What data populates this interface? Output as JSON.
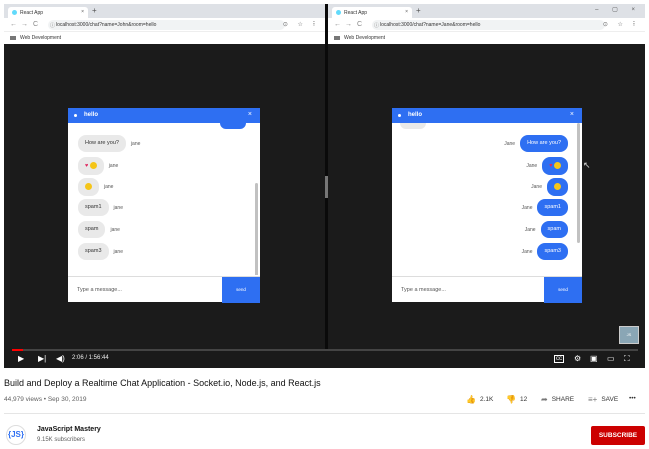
{
  "browser": {
    "tab_title": "React App",
    "tab_close": "×",
    "new_tab": "+",
    "window_controls": "–  ▢  ×",
    "nav": {
      "back": "←",
      "forward": "→",
      "reload": "C"
    },
    "bookmark": "Web Development",
    "toolbar_icons": "⊙ ☆ ⠇"
  },
  "left_pane": {
    "url": "localhost:3000/chat?name=John&room=hello",
    "chat": {
      "room": "hello",
      "close": "×",
      "messages": [
        {
          "text": "How are you?",
          "sender": "jane"
        },
        {
          "text": "♥",
          "sender": "jane"
        },
        {
          "text": "",
          "sender": "jane"
        },
        {
          "text": "spam1",
          "sender": "jane"
        },
        {
          "text": "spam",
          "sender": "jane"
        },
        {
          "text": "spam3",
          "sender": "jane"
        }
      ],
      "input_placeholder": "Type a message...",
      "send_label": "send"
    }
  },
  "right_pane": {
    "url": "localhost:3000/chat?name=Jane&room=hello",
    "chat": {
      "room": "hello",
      "close": "×",
      "messages": [
        {
          "text": "How are you?",
          "sender": "Jane"
        },
        {
          "text": "♥",
          "sender": "Jane"
        },
        {
          "text": "",
          "sender": "Jane"
        },
        {
          "text": "spam1",
          "sender": "Jane"
        },
        {
          "text": "spam",
          "sender": "Jane"
        },
        {
          "text": "spam3",
          "sender": "Jane"
        }
      ],
      "input_placeholder": "Type a message...",
      "send_label": "send"
    }
  },
  "player": {
    "time_current": "2:06",
    "time_total": "1:56:44",
    "time_display": "2:06 / 1:56:44",
    "progress_fraction": 0.018,
    "thumbnail_label": "JS"
  },
  "video": {
    "title": "Build and Deploy a Realtime Chat Application - Socket.io, Node.js, and React.js",
    "meta": "44,979 views • Sep 30, 2019",
    "likes": "2.1K",
    "dislikes": "12",
    "share_label": "SHARE",
    "save_label": "SAVE",
    "more": "•••"
  },
  "channel": {
    "avatar_text": "{JS}",
    "name": "JavaScript Mastery",
    "subscribers": "9.15K subscribers",
    "subscribe_label": "SUBSCRIBE"
  },
  "colors": {
    "accent": "#2e6ff2",
    "subscribe": "#cc0000",
    "progress": "#ff0000"
  }
}
